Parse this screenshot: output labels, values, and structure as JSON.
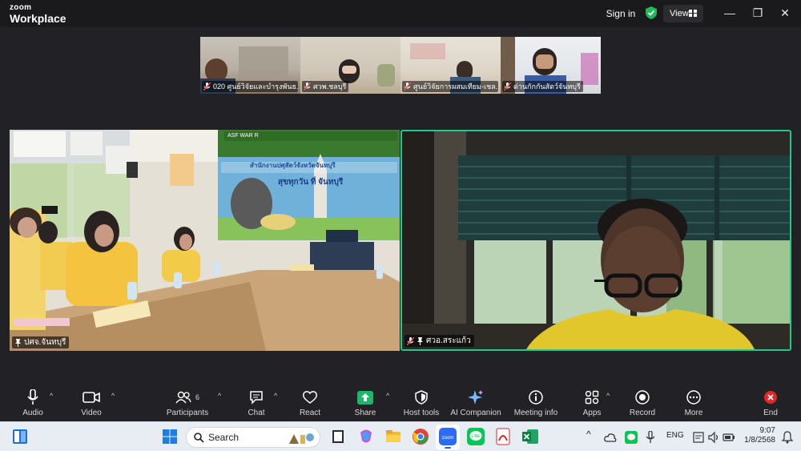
{
  "app": {
    "brand_line1": "zoom",
    "brand_line2": "Workplace"
  },
  "titlebar": {
    "sign_in": "Sign in",
    "view": "View",
    "minimize": "—",
    "restore": "❐",
    "close": "✕"
  },
  "thumbnails": [
    {
      "name": "020 ศูนย์วิจัยและบำรุงพันธ..."
    },
    {
      "name": "ศวพ.ชลบุรี"
    },
    {
      "name": "ศูนย์วิจัยการผสมเทียม-เชล..."
    },
    {
      "name": "ด่านกักกันสัตว์จันทบุรี"
    }
  ],
  "main_videos": [
    {
      "name": "ปศจ.จันทบุรี",
      "banner": "สำนักงานปศุสัตว์จังหวัดจันทบุรี",
      "slogan": "สุขทุกวัน ที่ จันทบุรี",
      "top_banner": "ASF WAR R"
    },
    {
      "name": "ศวอ.สระแก้ว",
      "active_speaker": true
    }
  ],
  "toolbar": {
    "audio": "Audio",
    "video": "Video",
    "participants": "Participants",
    "participants_count": "6",
    "chat": "Chat",
    "react": "React",
    "share": "Share",
    "host_tools": "Host tools",
    "ai_companion": "AI Companion",
    "meeting_info": "Meeting info",
    "apps": "Apps",
    "record": "Record",
    "more": "More",
    "end": "End"
  },
  "taskbar": {
    "search_placeholder": "Search",
    "lang": "ENG",
    "time": "9:07",
    "date": "1/8/2568"
  },
  "colors": {
    "active_speaker_border": "#22c98b",
    "share_green": "#1fb56b",
    "end_red": "#e02828",
    "taskbar_bg": "#e8edf4"
  }
}
